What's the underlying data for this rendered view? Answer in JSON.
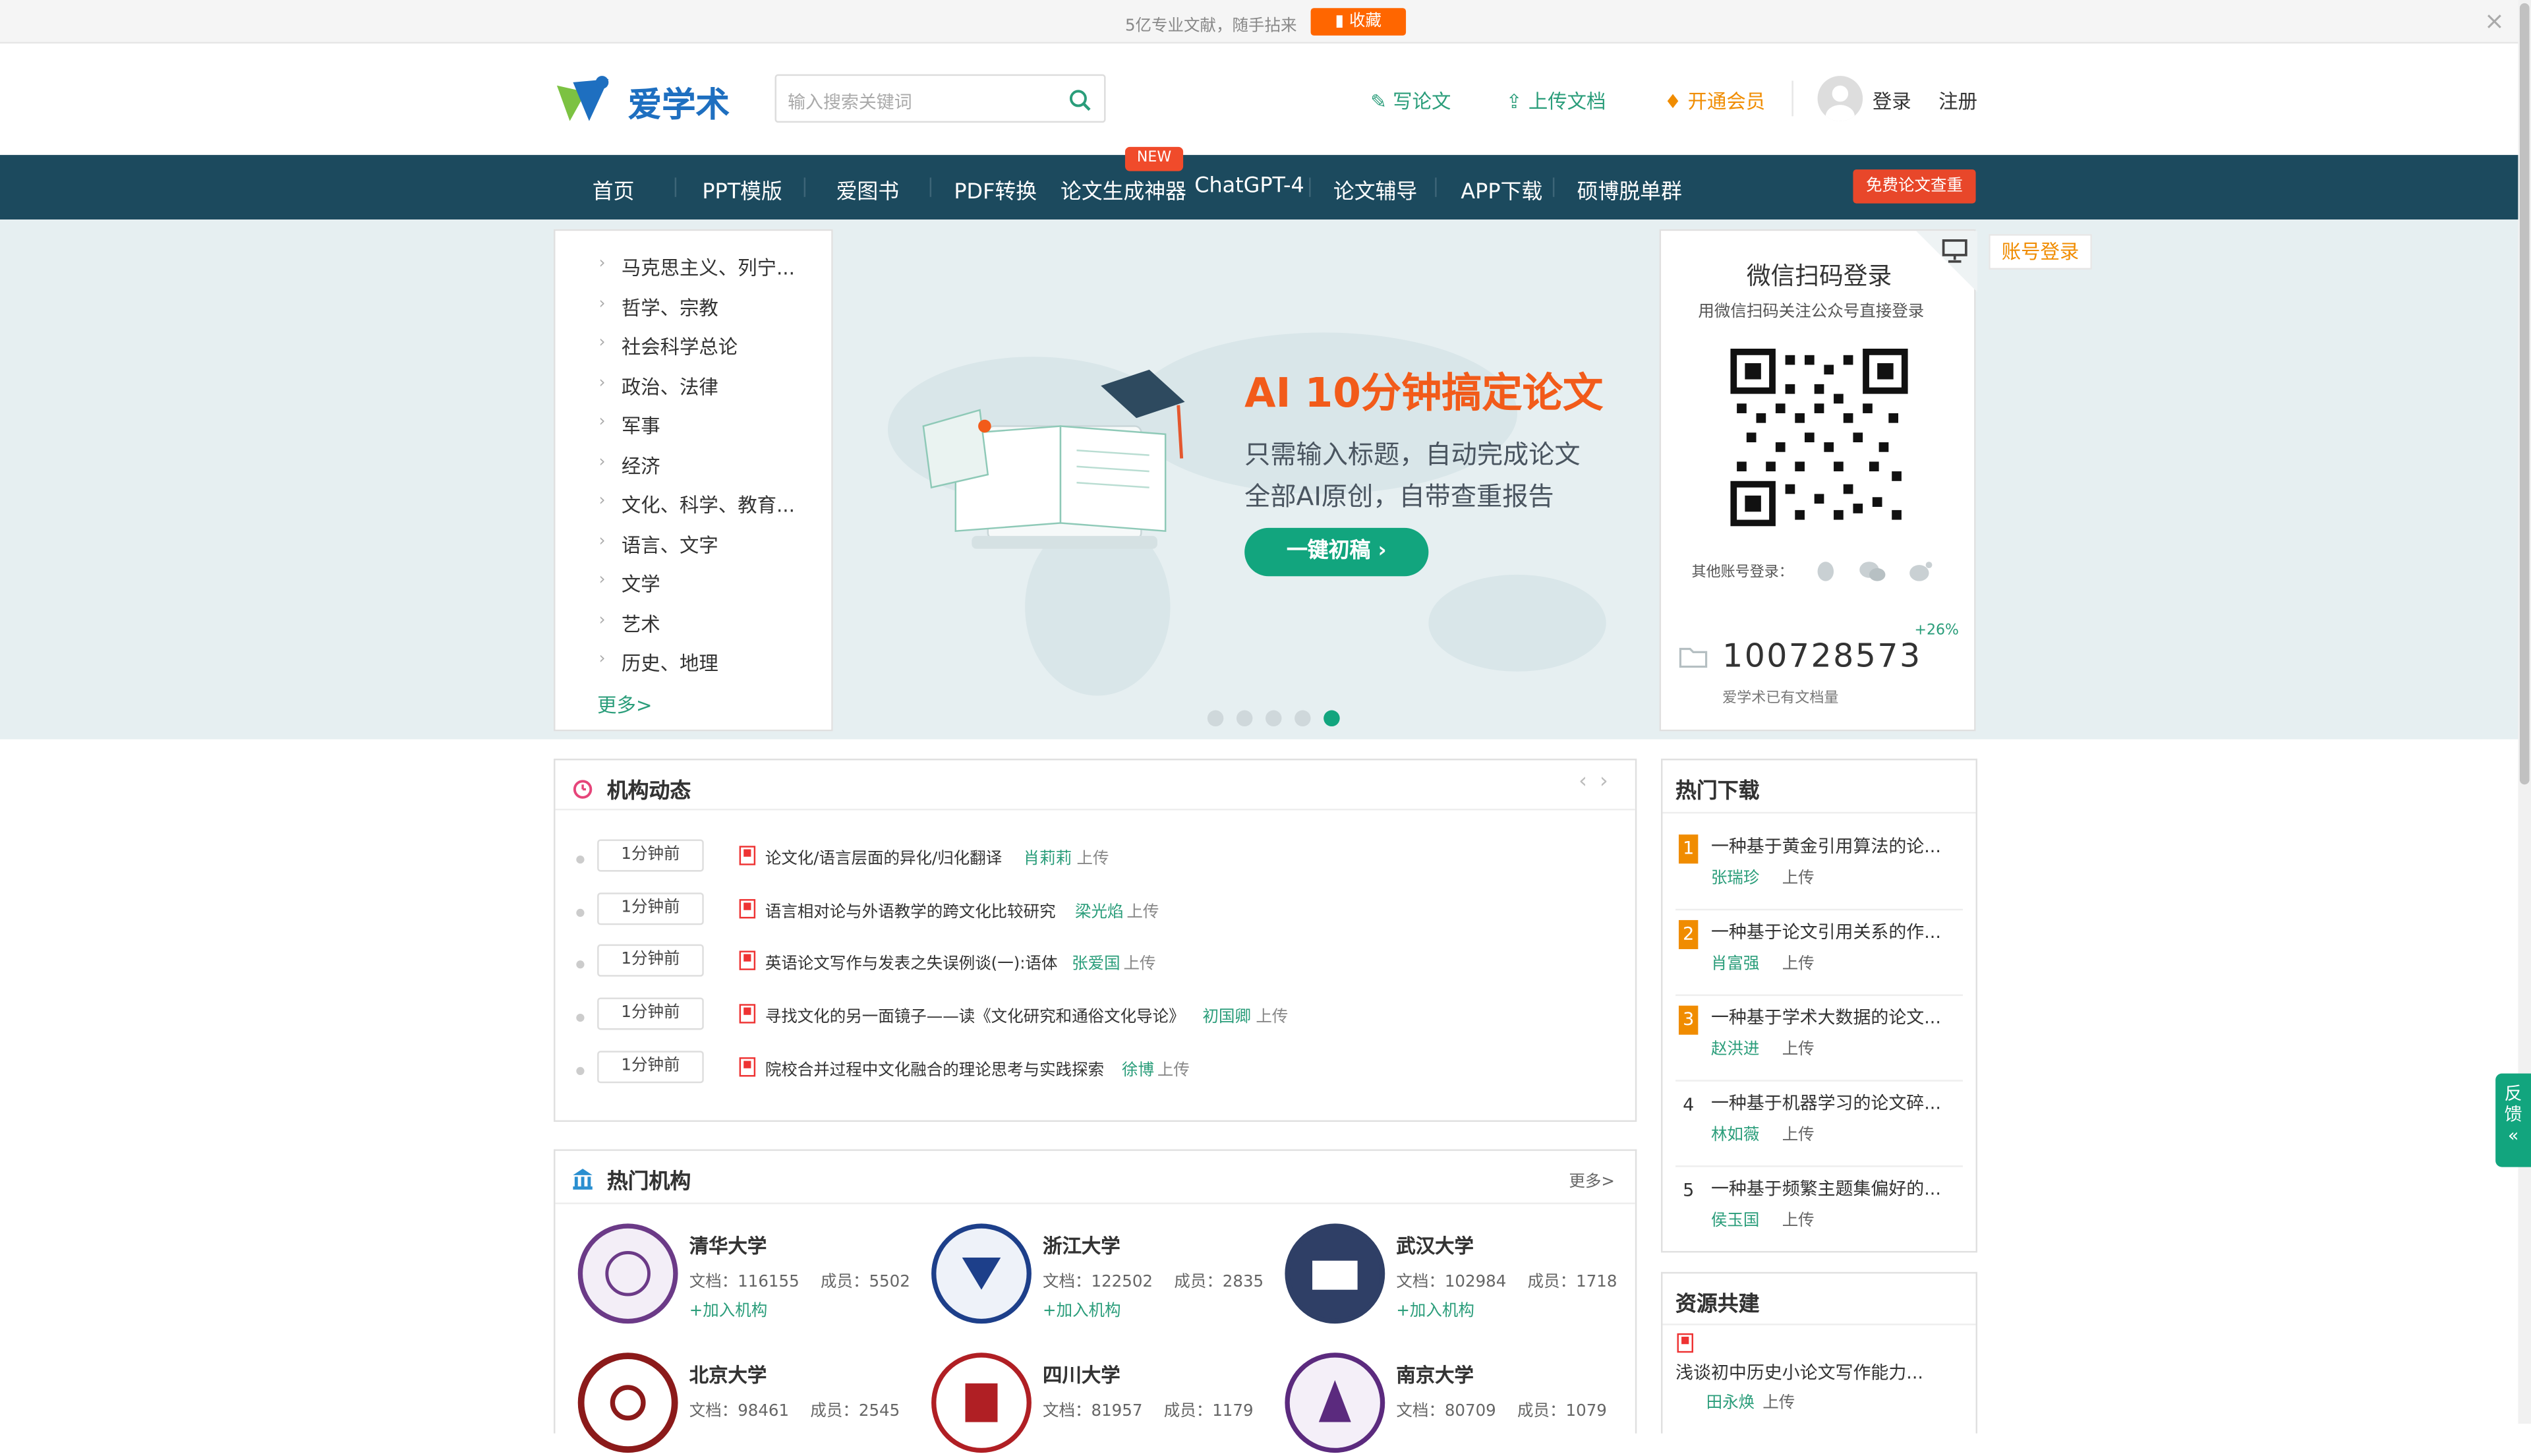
{
  "topbar": {
    "tip": "5亿专业文献，随手拈来",
    "fav_label": "收藏",
    "close": "×"
  },
  "header": {
    "logo_text": "爱学术",
    "search_placeholder": "输入搜索关键词",
    "links": {
      "write": "写论文",
      "upload": "上传文档",
      "vip": "开通会员",
      "login": "登录",
      "register": "注册"
    }
  },
  "nav": {
    "items": [
      "首页",
      "PPT模版",
      "爱图书",
      "PDF转换",
      "论文生成神器",
      "ChatGPT-4",
      "论文辅导",
      "APP下载",
      "硕博脱单群"
    ],
    "new_badge": "NEW",
    "free_check": "免费论文查重"
  },
  "categories": {
    "items": [
      "马克思主义、列宁...",
      "哲学、宗教",
      "社会科学总论",
      "政治、法律",
      "军事",
      "经济",
      "文化、科学、教育...",
      "语言、文字",
      "文学",
      "艺术",
      "历史、地理"
    ],
    "more": "更多>"
  },
  "banner": {
    "headline": "AI 10分钟搞定论文",
    "line1": "只需输入标题，自动完成论文",
    "line2": "全部AI原创，自带查重报告",
    "button": "一键初稿",
    "active_slide": 5,
    "slides": 5
  },
  "login": {
    "title": "微信扫码登录",
    "subtitle": "用微信扫码关注公众号直接登录",
    "other": "其他账号登录：",
    "account_login": "账号登录",
    "doc_count": "100728573",
    "growth": "+26%",
    "doc_caption": "爱学术已有文档量"
  },
  "institution_feed": {
    "title": "机构动态",
    "rows": [
      {
        "time": "1分钟前",
        "title": "论文化/语言层面的异化/归化翻译",
        "author": "肖莉莉",
        "action": "上传"
      },
      {
        "time": "1分钟前",
        "title": "语言相对论与外语教学的跨文化比较研究",
        "author": "梁光焰",
        "action": "上传"
      },
      {
        "time": "1分钟前",
        "title": "英语论文写作与发表之失误例谈(一):语体",
        "author": "张爱国",
        "action": "上传"
      },
      {
        "time": "1分钟前",
        "title": "寻找文化的另一面镜子——读《文化研究和通俗文化导论》",
        "author": "初国卿",
        "action": "上传"
      },
      {
        "time": "1分钟前",
        "title": "院校合并过程中文化融合的理论思考与实践探索",
        "author": "徐博",
        "action": "上传"
      }
    ]
  },
  "hot_institutions": {
    "title": "热门机构",
    "more": "更多>",
    "join": "+加入机构",
    "doc_label": "文档：",
    "member_label": "成员：",
    "items": [
      {
        "name": "清华大学",
        "docs": "116155",
        "members": "5502",
        "color": "#6b3a87"
      },
      {
        "name": "浙江大学",
        "docs": "122502",
        "members": "2835",
        "color": "#1d3f8a"
      },
      {
        "name": "武汉大学",
        "docs": "102984",
        "members": "1718",
        "color": "#2f3f66"
      },
      {
        "name": "北京大学",
        "docs": "98461",
        "members": "2545",
        "color": "#8b1a1a"
      },
      {
        "name": "四川大学",
        "docs": "81957",
        "members": "1179",
        "color": "#b01f24"
      },
      {
        "name": "南京大学",
        "docs": "80709",
        "members": "1079",
        "color": "#5b2a7e"
      }
    ]
  },
  "hot_downloads": {
    "title": "热门下载",
    "items": [
      {
        "rank": "1",
        "title": "一种基于黄金引用算法的论...",
        "author": "张瑞珍",
        "action": "上传"
      },
      {
        "rank": "2",
        "title": "一种基于论文引用关系的作...",
        "author": "肖富强",
        "action": "上传"
      },
      {
        "rank": "3",
        "title": "一种基于学术大数据的论文...",
        "author": "赵洪进",
        "action": "上传"
      },
      {
        "rank": "4",
        "title": "一种基于机器学习的论文碎...",
        "author": "林如薇",
        "action": "上传"
      },
      {
        "rank": "5",
        "title": "一种基于频繁主题集偏好的...",
        "author": "侯玉国",
        "action": "上传"
      }
    ]
  },
  "resource": {
    "title": "资源共建",
    "item_title": "浅谈初中历史小论文写作能力...",
    "author": "田永焕",
    "action": "上传"
  },
  "feedback": {
    "label1": "反",
    "label2": "馈",
    "arrow": "«"
  }
}
